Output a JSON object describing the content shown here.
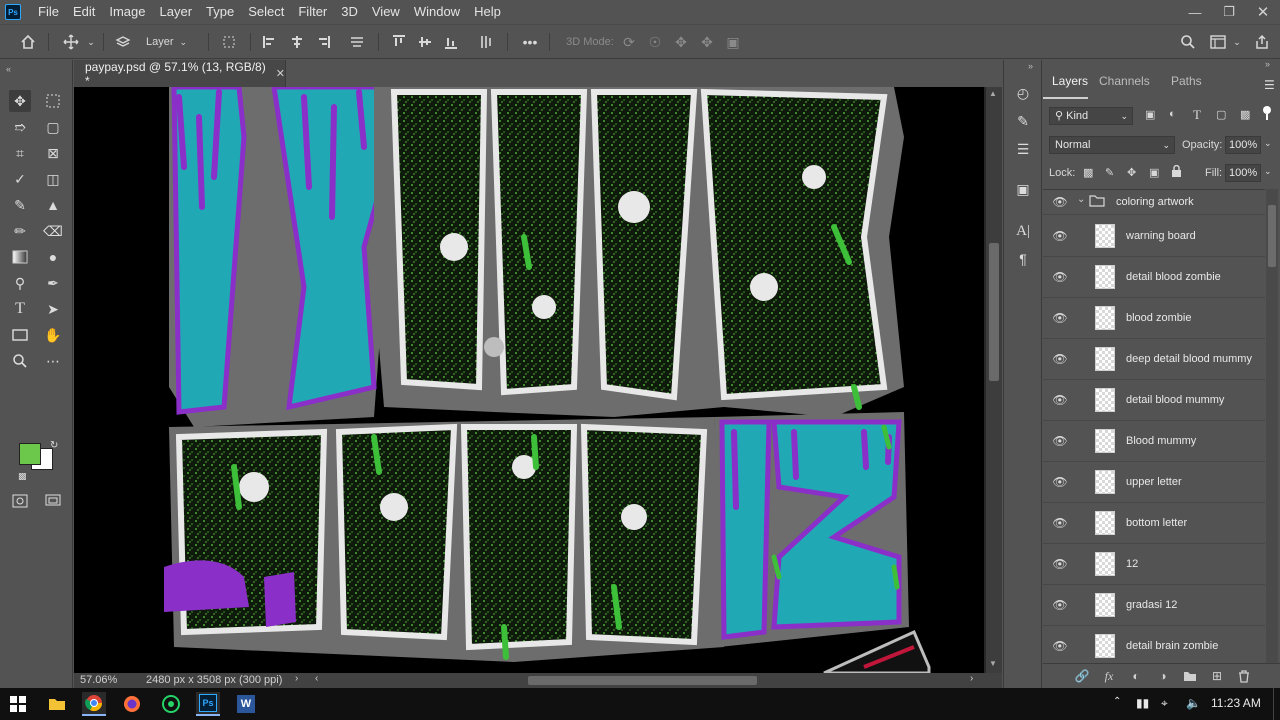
{
  "menu": {
    "logo": "Ps",
    "items": [
      "File",
      "Edit",
      "Image",
      "Layer",
      "Type",
      "Select",
      "Filter",
      "3D",
      "View",
      "Window",
      "Help"
    ],
    "window_controls": [
      "minimize",
      "restore",
      "close"
    ]
  },
  "options_bar": {
    "auto_select_target": "Layer",
    "mode_3d_label": "3D Mode:",
    "more_label": "•••"
  },
  "document": {
    "tab_title": "paypay.psd @ 57.1% (13, RGB/8) *",
    "zoom": "57.06%",
    "doc_info": "2480 px x 3508 px (300 ppi)"
  },
  "toolbar": {
    "foreground_color": "#6cc84a",
    "background_color": "#ffffff"
  },
  "layers_panel": {
    "tabs": [
      "Layers",
      "Channels",
      "Paths"
    ],
    "active_tab": "Layers",
    "filter_kind": "Kind",
    "blend_mode": "Normal",
    "opacity_label": "Opacity:",
    "opacity_value": "100%",
    "lock_label": "Lock:",
    "fill_label": "Fill:",
    "fill_value": "100%",
    "group": {
      "name": "coloring artwork"
    },
    "layers": [
      {
        "name": "warning board"
      },
      {
        "name": "detail blood zombie"
      },
      {
        "name": "blood zombie"
      },
      {
        "name": "deep detail blood mummy"
      },
      {
        "name": "detail blood mummy"
      },
      {
        "name": "Blood mummy"
      },
      {
        "name": "upper letter"
      },
      {
        "name": "bottom letter"
      },
      {
        "name": "12"
      },
      {
        "name": "gradasi 12"
      },
      {
        "name": "detail brain zombie"
      }
    ]
  },
  "taskbar": {
    "apps": [
      "start",
      "file-explorer",
      "chrome",
      "firefox",
      "whatsapp",
      "photoshop",
      "word"
    ],
    "time": "11:23 AM"
  },
  "colors": {
    "teal": "#21a8b5",
    "purple": "#8b2fc9",
    "slime_green": "#3dbf3a",
    "dark_green": "#1d3a14",
    "gray": "#7a7a7a",
    "white": "#ececec"
  }
}
